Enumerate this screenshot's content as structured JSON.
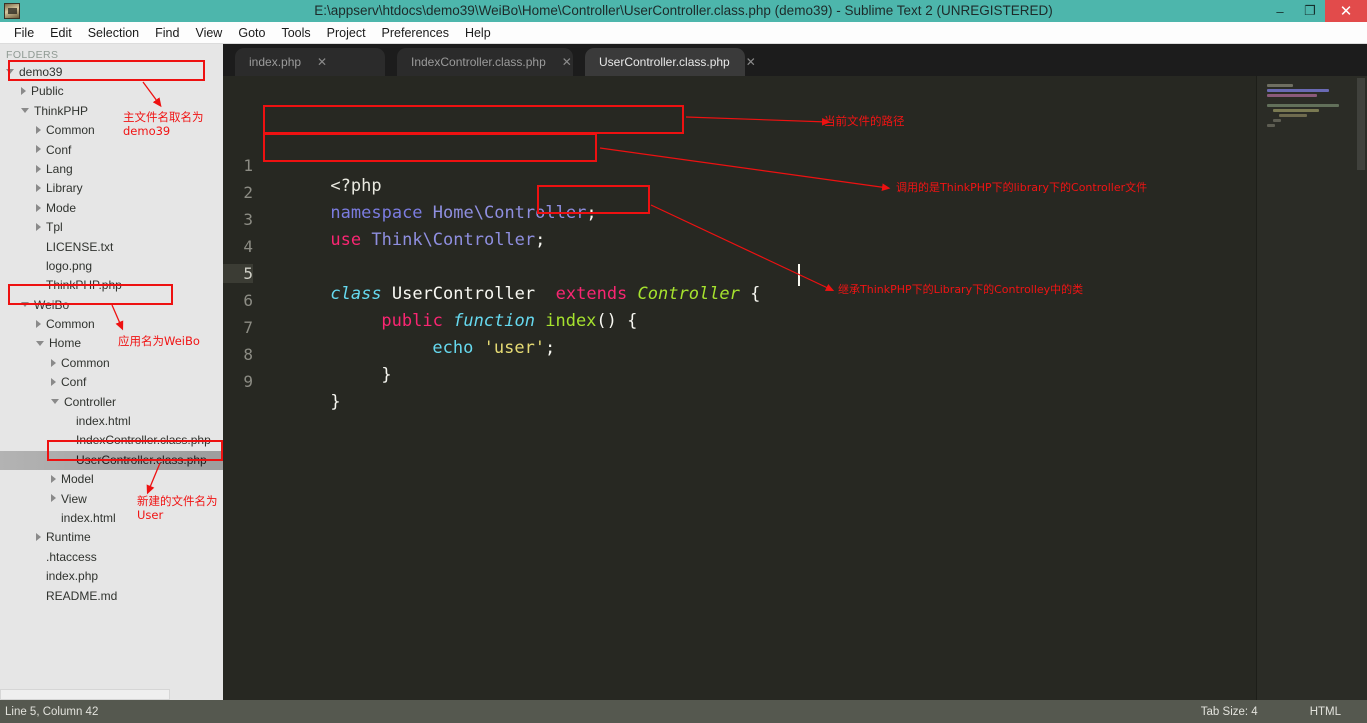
{
  "window": {
    "title": "E:\\appserv\\htdocs\\demo39\\WeiBo\\Home\\Controller\\UserController.class.php (demo39) - Sublime Text 2 (UNREGISTERED)",
    "minimize_label": "–",
    "maximize_label": "❐",
    "close_label": "✕",
    "icon": "sublime-text-icon",
    "titlebar_color": "#4db6ac",
    "close_button_color": "#e24b4b"
  },
  "menubar": {
    "items": [
      {
        "label": "File"
      },
      {
        "label": "Edit"
      },
      {
        "label": "Selection"
      },
      {
        "label": "Find"
      },
      {
        "label": "View"
      },
      {
        "label": "Goto"
      },
      {
        "label": "Tools"
      },
      {
        "label": "Project"
      },
      {
        "label": "Preferences"
      },
      {
        "label": "Help"
      }
    ]
  },
  "sidebar": {
    "header": "FOLDERS",
    "tree": [
      {
        "label": "demo39",
        "indent": 0,
        "state": "open",
        "type": "folder",
        "boxed": true
      },
      {
        "label": "Public",
        "indent": 1,
        "state": "closed",
        "type": "folder"
      },
      {
        "label": "ThinkPHP",
        "indent": 1,
        "state": "open",
        "type": "folder"
      },
      {
        "label": "Common",
        "indent": 2,
        "state": "closed",
        "type": "folder"
      },
      {
        "label": "Conf",
        "indent": 2,
        "state": "closed",
        "type": "folder"
      },
      {
        "label": "Lang",
        "indent": 2,
        "state": "closed",
        "type": "folder"
      },
      {
        "label": "Library",
        "indent": 2,
        "state": "closed",
        "type": "folder"
      },
      {
        "label": "Mode",
        "indent": 2,
        "state": "closed",
        "type": "folder"
      },
      {
        "label": "Tpl",
        "indent": 2,
        "state": "closed",
        "type": "folder"
      },
      {
        "label": "LICENSE.txt",
        "indent": 2,
        "state": "none",
        "type": "file"
      },
      {
        "label": "logo.png",
        "indent": 2,
        "state": "none",
        "type": "file"
      },
      {
        "label": "ThinkPHP.php",
        "indent": 2,
        "state": "none",
        "type": "file"
      },
      {
        "label": "WeiBo",
        "indent": 1,
        "state": "open",
        "type": "folder",
        "boxed": true
      },
      {
        "label": "Common",
        "indent": 2,
        "state": "closed",
        "type": "folder"
      },
      {
        "label": "Home",
        "indent": 2,
        "state": "open",
        "type": "folder"
      },
      {
        "label": "Common",
        "indent": 3,
        "state": "closed",
        "type": "folder"
      },
      {
        "label": "Conf",
        "indent": 3,
        "state": "closed",
        "type": "folder"
      },
      {
        "label": "Controller",
        "indent": 3,
        "state": "open",
        "type": "folder"
      },
      {
        "label": "index.html",
        "indent": 4,
        "state": "none",
        "type": "file"
      },
      {
        "label": "IndexController.class.php",
        "indent": 4,
        "state": "none",
        "type": "file"
      },
      {
        "label": "UserController.class.php",
        "indent": 4,
        "state": "none",
        "type": "file",
        "selected": true,
        "boxed": true
      },
      {
        "label": "Model",
        "indent": 3,
        "state": "closed",
        "type": "folder"
      },
      {
        "label": "View",
        "indent": 3,
        "state": "closed",
        "type": "folder"
      },
      {
        "label": "index.html",
        "indent": 3,
        "state": "none",
        "type": "file"
      },
      {
        "label": "Runtime",
        "indent": 2,
        "state": "closed",
        "type": "folder"
      },
      {
        "label": ".htaccess",
        "indent": 2,
        "state": "none",
        "type": "file"
      },
      {
        "label": "index.php",
        "indent": 2,
        "state": "none",
        "type": "file"
      },
      {
        "label": "README.md",
        "indent": 2,
        "state": "none",
        "type": "file"
      }
    ]
  },
  "tabs": [
    {
      "label": "index.php",
      "active": false,
      "close": "✕"
    },
    {
      "label": "IndexController.class.php",
      "active": false,
      "close": "✕"
    },
    {
      "label": "UserController.class.php",
      "active": true,
      "close": "✕"
    }
  ],
  "editor": {
    "line_numbers": [
      "1",
      "2",
      "3",
      "4",
      "5",
      "6",
      "7",
      "8",
      "9"
    ],
    "active_line": 5,
    "code": [
      "<?php",
      "namespace Home\\Controller;",
      "use Think\\Controller;",
      "",
      "class UserController extends Controller {",
      "    public function index() {",
      "        echo 'user';",
      "    }",
      "}"
    ],
    "tokens": {
      "php_open": "<?php",
      "namespace_kw": "namespace",
      "namespace_path": "Home\\Controller",
      "use_kw": "use",
      "use_path": "Think\\Controller",
      "class_kw": "class",
      "class_name": "UserController",
      "extends_kw": "extends",
      "parent_class": "Controller",
      "brace_open": "{",
      "public_kw": "public",
      "function_kw": "function",
      "method_name": "index",
      "parens": "()",
      "echo_kw": "echo",
      "string_literal": "'user'",
      "semicolon": ";",
      "brace_close": "}"
    }
  },
  "annotations": [
    {
      "id": "main-file-name",
      "text": "主文件名取名为\ndemo39"
    },
    {
      "id": "app-name",
      "text": "应用名为WeiBo"
    },
    {
      "id": "new-file-name",
      "text": "新建的文件名为\nUser"
    },
    {
      "id": "current-path",
      "text": "当前文件的路径"
    },
    {
      "id": "calls-controller",
      "text": "调用的是ThinkPHP下的library下的Controller文件"
    },
    {
      "id": "extends-class",
      "text": "继承ThinkPHP下的Library下的Controlley中的类"
    }
  ],
  "statusbar": {
    "position": "Line 5, Column 42",
    "tab_size": "Tab Size: 4",
    "syntax": "HTML"
  }
}
